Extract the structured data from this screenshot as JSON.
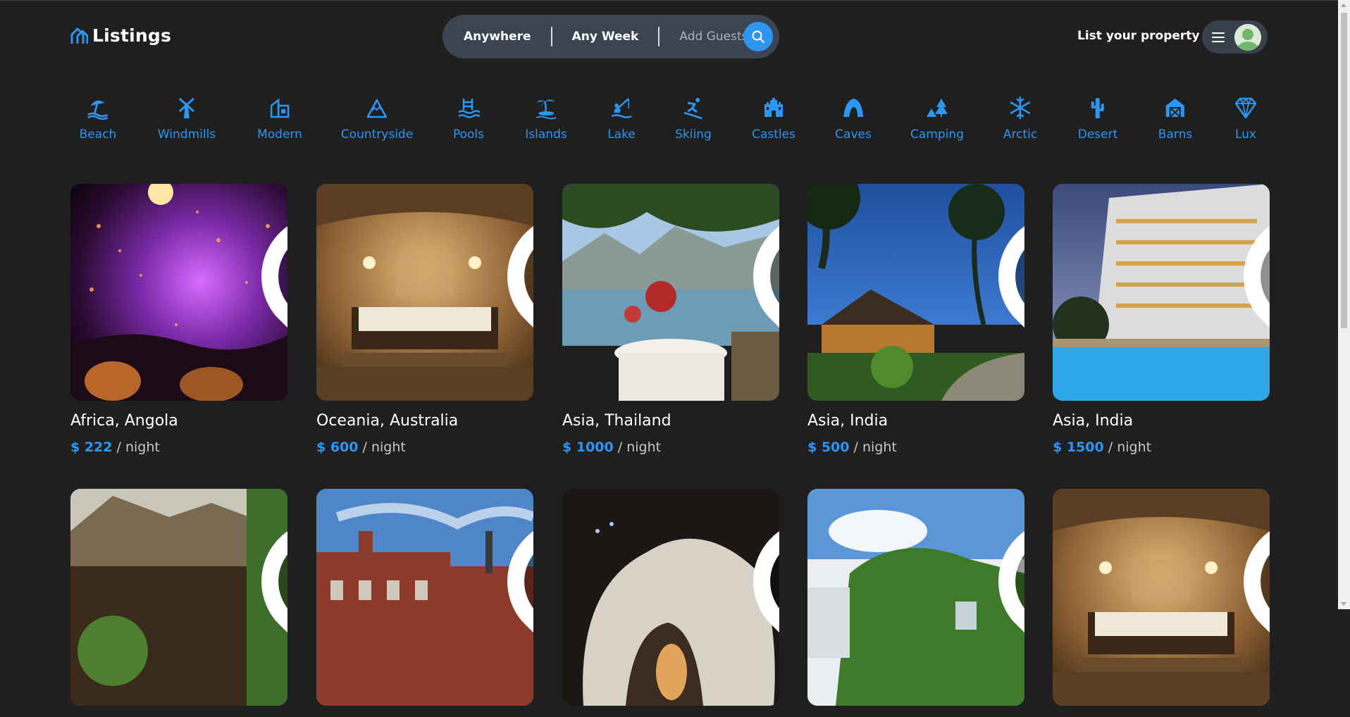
{
  "app": {
    "logo_text": "Listings",
    "accent_color": "#2d96f3"
  },
  "search": {
    "where": "Anywhere",
    "when": "Any Week",
    "guests_placeholder": "Add Guests",
    "button_icon": "search-icon"
  },
  "header": {
    "list_property": "List your property",
    "menu_icon": "hamburger-menu-icon",
    "avatar": "user-avatar"
  },
  "categories": [
    {
      "label": "Beach",
      "icon": "beach-umbrella-icon"
    },
    {
      "label": "Windmills",
      "icon": "windmill-icon"
    },
    {
      "label": "Modern",
      "icon": "modern-building-icon"
    },
    {
      "label": "Countryside",
      "icon": "mountain-icon"
    },
    {
      "label": "Pools",
      "icon": "pool-ladder-icon"
    },
    {
      "label": "Islands",
      "icon": "island-palm-icon"
    },
    {
      "label": "Lake",
      "icon": "lake-fishing-icon"
    },
    {
      "label": "Skiing",
      "icon": "skier-icon"
    },
    {
      "label": "Castles",
      "icon": "castle-icon"
    },
    {
      "label": "Caves",
      "icon": "cave-icon"
    },
    {
      "label": "Camping",
      "icon": "tent-tree-icon"
    },
    {
      "label": "Arctic",
      "icon": "snowflake-icon"
    },
    {
      "label": "Desert",
      "icon": "cactus-icon"
    },
    {
      "label": "Barns",
      "icon": "barn-icon"
    },
    {
      "label": "Lux",
      "icon": "diamond-icon"
    }
  ],
  "listings": [
    {
      "location": "Africa, Angola",
      "price": "$ 222",
      "unit": "/ night",
      "photo": "concert-crowd-photo"
    },
    {
      "location": "Oceania, Australia",
      "price": "$ 600",
      "unit": "/ night",
      "photo": "cave-bedroom-photo"
    },
    {
      "location": "Asia, Thailand",
      "price": "$ 1000",
      "unit": "/ night",
      "photo": "seaside-terrace-photo"
    },
    {
      "location": "Asia, India",
      "price": "$ 500",
      "unit": "/ night",
      "photo": "tropical-resort-photo"
    },
    {
      "location": "Asia, India",
      "price": "$ 1500",
      "unit": "/ night",
      "photo": "hotel-pool-photo"
    },
    {
      "location": "",
      "price": "",
      "unit": "",
      "photo": "thatched-lodge-photo"
    },
    {
      "location": "",
      "price": "",
      "unit": "",
      "photo": "brick-manor-photo"
    },
    {
      "location": "",
      "price": "",
      "unit": "",
      "photo": "white-cave-photo"
    },
    {
      "location": "",
      "price": "",
      "unit": "",
      "photo": "ivy-house-photo"
    },
    {
      "location": "",
      "price": "",
      "unit": "",
      "photo": "cave-bedroom-photo"
    }
  ]
}
